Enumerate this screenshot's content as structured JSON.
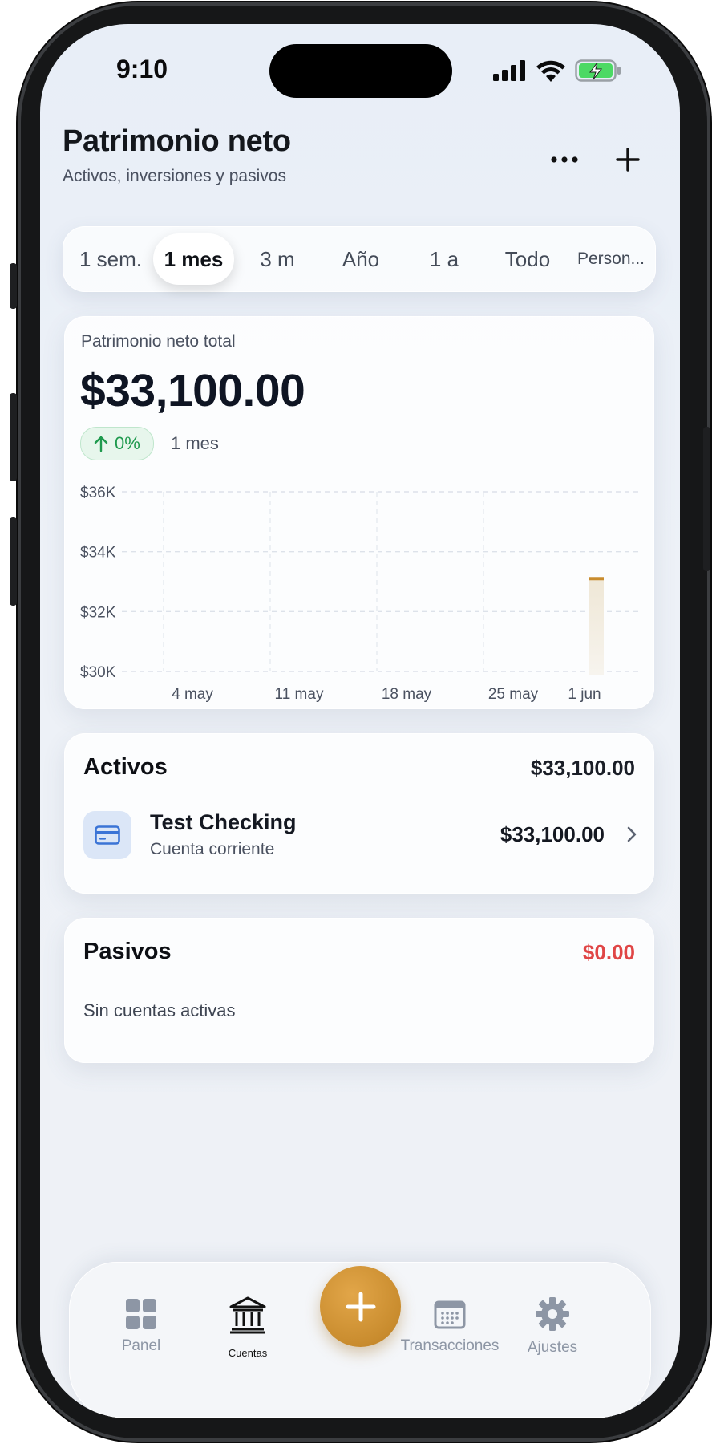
{
  "status_bar": {
    "time": "9:10"
  },
  "header": {
    "title": "Patrimonio neto",
    "subtitle": "Activos, inversiones y pasivos",
    "more_icon": "ellipsis-icon",
    "add_icon": "plus-icon"
  },
  "period_selector": {
    "selected": "1 mes",
    "options": [
      "1 sem.",
      "1 mes",
      "3 m",
      "Año",
      "1 a",
      "Todo",
      "Person..."
    ]
  },
  "net_worth": {
    "label": "Patrimonio neto total",
    "value": "$33,100.00",
    "change": "0%",
    "change_icon": "arrow-up-icon",
    "period": "1 mes"
  },
  "chart_data": {
    "type": "bar",
    "y_tick_labels": [
      "$36K",
      "$34K",
      "$32K",
      "$30K"
    ],
    "x_tick_labels": [
      "4 may",
      "11 may",
      "18 may",
      "25 may",
      "1 jun"
    ],
    "ylim": [
      30000,
      36000
    ],
    "grid": true,
    "series": [
      {
        "values": [
          {
            "x": "2 jun",
            "y": 33100
          }
        ]
      }
    ],
    "bar_color": "#c98c2e"
  },
  "assets": {
    "title": "Activos",
    "total": "$33,100.00",
    "accounts": [
      {
        "name": "Test Checking",
        "type": "Cuenta corriente",
        "amount": "$33,100.00",
        "icon": "credit-card-icon"
      }
    ]
  },
  "liabilities": {
    "title": "Pasivos",
    "total": "$0.00",
    "total_color": "#e04646",
    "empty_text": "Sin cuentas activas"
  },
  "tab_bar": {
    "tabs": [
      {
        "label": "Panel",
        "icon": "grid-icon"
      },
      {
        "label": "Cuentas",
        "icon": "bank-icon",
        "active": true
      },
      {
        "label": "Transacciones",
        "icon": "calendar-icon"
      },
      {
        "label": "Ajustes",
        "icon": "gear-icon"
      }
    ],
    "fab_icon": "plus-icon"
  },
  "colors": {
    "accent": "#c98c2e",
    "positive": "#1f9a4e",
    "negative": "#e04646"
  }
}
